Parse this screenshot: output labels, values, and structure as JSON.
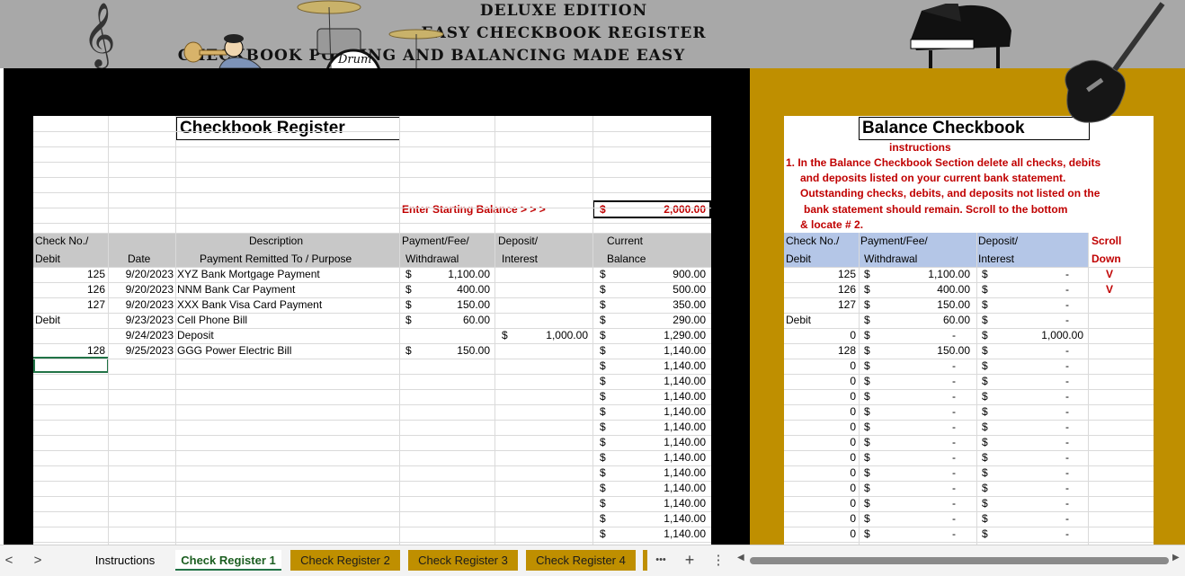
{
  "header": {
    "line1": "DELUXE EDITION",
    "line2": "EASY CHECKBOOK REGISTER",
    "line3": "CHECKBOOK POSTING AND BALANCING MADE EASY",
    "drum_logo": "Drum"
  },
  "register": {
    "title": "Checkbook Register",
    "start_label": "Enter Starting Balance > > >",
    "start_dollar": "$",
    "start_value": "2,000.00",
    "headers": {
      "check1": "Check No./",
      "check2": "Debit",
      "date": "Date",
      "desc1": "Description",
      "desc2": "Payment Remitted To / Purpose",
      "pay1": "Payment/Fee/",
      "pay2": "Withdrawal",
      "dep1": "Deposit/",
      "dep2": "Interest",
      "bal1": "Current",
      "bal2": "Balance"
    },
    "rows": [
      {
        "check": "125",
        "date": "9/20/2023",
        "desc": "XYZ Bank Mortgage Payment",
        "pay_sign": "$",
        "pay": "1,100.00",
        "dep_sign": "",
        "dep": "",
        "bal_sign": "$",
        "bal": "900.00"
      },
      {
        "check": "126",
        "date": "9/20/2023",
        "desc": "NNM Bank Car Payment",
        "pay_sign": "$",
        "pay": "400.00",
        "dep_sign": "",
        "dep": "",
        "bal_sign": "$",
        "bal": "500.00"
      },
      {
        "check": "127",
        "date": "9/20/2023",
        "desc": "XXX Bank Visa Card Payment",
        "pay_sign": "$",
        "pay": "150.00",
        "dep_sign": "",
        "dep": "",
        "bal_sign": "$",
        "bal": "350.00"
      },
      {
        "check": "Debit",
        "date": "9/23/2023",
        "desc": "Cell Phone Bill",
        "pay_sign": "$",
        "pay": "60.00",
        "dep_sign": "",
        "dep": "",
        "bal_sign": "$",
        "bal": "290.00"
      },
      {
        "check": "",
        "date": "9/24/2023",
        "desc": "Deposit",
        "pay_sign": "",
        "pay": "",
        "dep_sign": "$",
        "dep": "1,000.00",
        "bal_sign": "$",
        "bal": "1,290.00"
      },
      {
        "check": "128",
        "date": "9/25/2023",
        "desc": "GGG Power Electric Bill",
        "pay_sign": "$",
        "pay": "150.00",
        "dep_sign": "",
        "dep": "",
        "bal_sign": "$",
        "bal": "1,140.00"
      },
      {
        "check": "",
        "date": "",
        "desc": "",
        "pay_sign": "",
        "pay": "",
        "dep_sign": "",
        "dep": "",
        "bal_sign": "$",
        "bal": "1,140.00"
      },
      {
        "check": "",
        "date": "",
        "desc": "",
        "pay_sign": "",
        "pay": "",
        "dep_sign": "",
        "dep": "",
        "bal_sign": "$",
        "bal": "1,140.00"
      },
      {
        "check": "",
        "date": "",
        "desc": "",
        "pay_sign": "",
        "pay": "",
        "dep_sign": "",
        "dep": "",
        "bal_sign": "$",
        "bal": "1,140.00"
      },
      {
        "check": "",
        "date": "",
        "desc": "",
        "pay_sign": "",
        "pay": "",
        "dep_sign": "",
        "dep": "",
        "bal_sign": "$",
        "bal": "1,140.00"
      },
      {
        "check": "",
        "date": "",
        "desc": "",
        "pay_sign": "",
        "pay": "",
        "dep_sign": "",
        "dep": "",
        "bal_sign": "$",
        "bal": "1,140.00"
      },
      {
        "check": "",
        "date": "",
        "desc": "",
        "pay_sign": "",
        "pay": "",
        "dep_sign": "",
        "dep": "",
        "bal_sign": "$",
        "bal": "1,140.00"
      },
      {
        "check": "",
        "date": "",
        "desc": "",
        "pay_sign": "",
        "pay": "",
        "dep_sign": "",
        "dep": "",
        "bal_sign": "$",
        "bal": "1,140.00"
      },
      {
        "check": "",
        "date": "",
        "desc": "",
        "pay_sign": "",
        "pay": "",
        "dep_sign": "",
        "dep": "",
        "bal_sign": "$",
        "bal": "1,140.00"
      },
      {
        "check": "",
        "date": "",
        "desc": "",
        "pay_sign": "",
        "pay": "",
        "dep_sign": "",
        "dep": "",
        "bal_sign": "$",
        "bal": "1,140.00"
      },
      {
        "check": "",
        "date": "",
        "desc": "",
        "pay_sign": "",
        "pay": "",
        "dep_sign": "",
        "dep": "",
        "bal_sign": "$",
        "bal": "1,140.00"
      },
      {
        "check": "",
        "date": "",
        "desc": "",
        "pay_sign": "",
        "pay": "",
        "dep_sign": "",
        "dep": "",
        "bal_sign": "$",
        "bal": "1,140.00"
      },
      {
        "check": "",
        "date": "",
        "desc": "",
        "pay_sign": "",
        "pay": "",
        "dep_sign": "",
        "dep": "",
        "bal_sign": "$",
        "bal": "1,140.00"
      }
    ]
  },
  "balance": {
    "title": "Balance Checkbook",
    "instructions_label": "instructions",
    "instructions": [
      "1. In the Balance Checkbook Section delete all checks, debits",
      "and deposits listed on your current bank statement.",
      "Outstanding checks, debits, and deposits not listed on the",
      "bank statement should remain.  Scroll to the bottom",
      "& locate # 2."
    ],
    "headers": {
      "check1": "Check No./",
      "check2": "Debit",
      "pay1": "Payment/Fee/",
      "pay2": "Withdrawal",
      "dep1": "Deposit/",
      "dep2": "Interest",
      "scroll1": "Scroll",
      "scroll2": "Down"
    },
    "rows": [
      {
        "check": "125",
        "pay_sign": "$",
        "pay": "1,100.00",
        "dep_sign": "$",
        "dep": "-",
        "scroll": "V"
      },
      {
        "check": "126",
        "pay_sign": "$",
        "pay": "400.00",
        "dep_sign": "$",
        "dep": "-",
        "scroll": "V"
      },
      {
        "check": "127",
        "pay_sign": "$",
        "pay": "150.00",
        "dep_sign": "$",
        "dep": "-",
        "scroll": ""
      },
      {
        "check": "Debit",
        "pay_sign": "$",
        "pay": "60.00",
        "dep_sign": "$",
        "dep": "-",
        "scroll": ""
      },
      {
        "check": "0",
        "pay_sign": "$",
        "pay": "-",
        "dep_sign": "$",
        "dep": "1,000.00",
        "scroll": ""
      },
      {
        "check": "128",
        "pay_sign": "$",
        "pay": "150.00",
        "dep_sign": "$",
        "dep": "-",
        "scroll": ""
      },
      {
        "check": "0",
        "pay_sign": "$",
        "pay": "-",
        "dep_sign": "$",
        "dep": "-",
        "scroll": ""
      },
      {
        "check": "0",
        "pay_sign": "$",
        "pay": "-",
        "dep_sign": "$",
        "dep": "-",
        "scroll": ""
      },
      {
        "check": "0",
        "pay_sign": "$",
        "pay": "-",
        "dep_sign": "$",
        "dep": "-",
        "scroll": ""
      },
      {
        "check": "0",
        "pay_sign": "$",
        "pay": "-",
        "dep_sign": "$",
        "dep": "-",
        "scroll": ""
      },
      {
        "check": "0",
        "pay_sign": "$",
        "pay": "-",
        "dep_sign": "$",
        "dep": "-",
        "scroll": ""
      },
      {
        "check": "0",
        "pay_sign": "$",
        "pay": "-",
        "dep_sign": "$",
        "dep": "-",
        "scroll": ""
      },
      {
        "check": "0",
        "pay_sign": "$",
        "pay": "-",
        "dep_sign": "$",
        "dep": "-",
        "scroll": ""
      },
      {
        "check": "0",
        "pay_sign": "$",
        "pay": "-",
        "dep_sign": "$",
        "dep": "-",
        "scroll": ""
      },
      {
        "check": "0",
        "pay_sign": "$",
        "pay": "-",
        "dep_sign": "$",
        "dep": "-",
        "scroll": ""
      },
      {
        "check": "0",
        "pay_sign": "$",
        "pay": "-",
        "dep_sign": "$",
        "dep": "-",
        "scroll": ""
      },
      {
        "check": "0",
        "pay_sign": "$",
        "pay": "-",
        "dep_sign": "$",
        "dep": "-",
        "scroll": ""
      },
      {
        "check": "0",
        "pay_sign": "$",
        "pay": "-",
        "dep_sign": "$",
        "dep": "-",
        "scroll": ""
      }
    ]
  },
  "tabs": {
    "items": [
      "Instructions",
      "Check Register 1",
      "Check Register 2",
      "Check Register 3",
      "Check Register 4"
    ],
    "active_index": 1,
    "more": "•••",
    "add": "+",
    "menu": "⋮",
    "prev": "<",
    "next": ">"
  },
  "colors": {
    "header_gray": "#a8a8a8",
    "gold": "#bf8f00",
    "header_row_gray": "#c8c8c8",
    "header_row_blue": "#b4c6e7",
    "accent_red": "#c00000"
  }
}
